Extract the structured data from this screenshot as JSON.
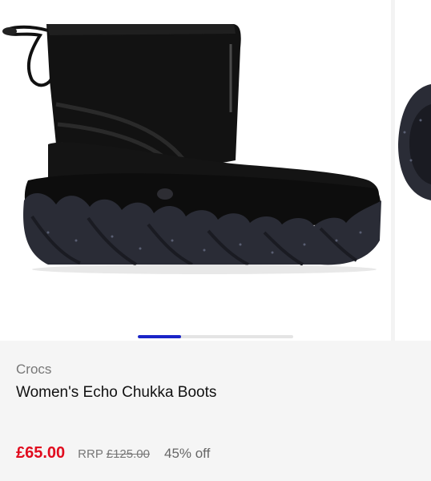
{
  "product": {
    "brand": "Crocs",
    "title": "Women's Echo Chukka Boots",
    "price": "£65.00",
    "rrp_label": "RRP",
    "rrp_price": "£125.00",
    "discount": "45% off"
  },
  "gallery": {
    "image_index_progress": 0.28
  },
  "colors": {
    "price": "#e10b1e",
    "progress": "#1a24c8"
  }
}
